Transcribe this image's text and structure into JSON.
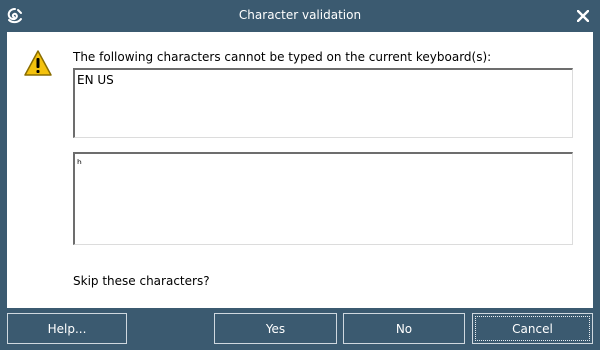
{
  "window": {
    "title": "Character validation",
    "app_icon": "swirl-logo-icon",
    "close_icon": "close-icon"
  },
  "dialog": {
    "icon": "warning-icon",
    "message": "The following characters cannot be typed on the current keyboard(s):",
    "keyboards_value": "EN US",
    "characters_value": "ʰ",
    "question": "Skip these characters?"
  },
  "buttons": {
    "help": "Help...",
    "yes": "Yes",
    "no": "No",
    "cancel": "Cancel"
  },
  "colors": {
    "chrome": "#3b5a70",
    "warning_fill": "#f4c20d"
  }
}
